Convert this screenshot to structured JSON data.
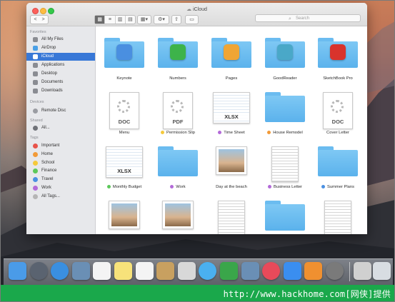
{
  "window": {
    "title": "iCloud",
    "search_placeholder": "Search",
    "nav_back": "<",
    "nav_forward": ">"
  },
  "sidebar": {
    "favorites_header": "Favorites",
    "favorites": [
      {
        "label": "All My Files",
        "icon": "all-files-icon"
      },
      {
        "label": "AirDrop",
        "icon": "airdrop-icon"
      },
      {
        "label": "iCloud",
        "icon": "icloud-icon",
        "active": true
      },
      {
        "label": "Applications",
        "icon": "applications-icon"
      },
      {
        "label": "Desktop",
        "icon": "desktop-icon"
      },
      {
        "label": "Documents",
        "icon": "documents-icon"
      },
      {
        "label": "Downloads",
        "icon": "downloads-icon"
      }
    ],
    "devices_header": "Devices",
    "devices": [
      {
        "label": "Remote Disc",
        "icon": "disc-icon"
      }
    ],
    "shared_header": "Shared",
    "shared": [
      {
        "label": "All...",
        "icon": "network-icon"
      }
    ],
    "tags_header": "Tags",
    "tags": [
      {
        "label": "Important",
        "color": "#e8534a"
      },
      {
        "label": "Home",
        "color": "#f29a38"
      },
      {
        "label": "School",
        "color": "#f5c93b"
      },
      {
        "label": "Finance",
        "color": "#5cc85a"
      },
      {
        "label": "Travel",
        "color": "#4a90e2"
      },
      {
        "label": "Work",
        "color": "#b36ad8"
      },
      {
        "label": "All Tags...",
        "color": "#b5b5b5"
      }
    ]
  },
  "files": [
    {
      "name": "Keynote",
      "kind": "folder",
      "app_color": "#4a8fe0"
    },
    {
      "name": "Numbers",
      "kind": "folder",
      "app_color": "#3db34a"
    },
    {
      "name": "Pages",
      "kind": "folder",
      "app_color": "#f0a534"
    },
    {
      "name": "GoodReader",
      "kind": "folder",
      "app_color": "#4aa8c8"
    },
    {
      "name": "SketchBook Pro",
      "kind": "folder",
      "app_color": "#d9332c"
    },
    {
      "name": "Menu",
      "kind": "doc",
      "ext": "DOC"
    },
    {
      "name": "Permission Slip",
      "kind": "doc",
      "ext": "PDF",
      "tag_color": "#f5c93b"
    },
    {
      "name": "Time Sheet",
      "kind": "sheet",
      "ext": "XLSX",
      "tag_color": "#b36ad8"
    },
    {
      "name": "House Remodel",
      "kind": "folder-plain",
      "tag_color": "#f29a38"
    },
    {
      "name": "Cover Letter",
      "kind": "doc",
      "ext": "DOC"
    },
    {
      "name": "Monthly Budget",
      "kind": "sheet",
      "ext": "XLSX",
      "tag_color": "#5cc85a"
    },
    {
      "name": "Work",
      "kind": "folder-plain",
      "tag_color": "#b36ad8"
    },
    {
      "name": "Day at the beach",
      "kind": "photo"
    },
    {
      "name": "Business Letter",
      "kind": "letter",
      "tag_color": "#b36ad8"
    },
    {
      "name": "Summer Plans",
      "kind": "folder-plain",
      "tag_color": "#4a90e2"
    },
    {
      "name": "",
      "kind": "photo"
    },
    {
      "name": "",
      "kind": "photo"
    },
    {
      "name": "",
      "kind": "letter"
    },
    {
      "name": "",
      "kind": "folder-plain"
    },
    {
      "name": "",
      "kind": "letter"
    }
  ],
  "dock": [
    {
      "name": "finder-icon",
      "color": "#4a9be8"
    },
    {
      "name": "launchpad-icon",
      "color": "#5a6370"
    },
    {
      "name": "safari-icon",
      "color": "#3a8fe0"
    },
    {
      "name": "photo-app-icon",
      "color": "#6a8fb5"
    },
    {
      "name": "calendar-icon",
      "color": "#f4f4f4"
    },
    {
      "name": "notes-icon",
      "color": "#f7e27a"
    },
    {
      "name": "reminders-icon",
      "color": "#f4f4f4"
    },
    {
      "name": "contacts-icon",
      "color": "#c8a060"
    },
    {
      "name": "preview-icon",
      "color": "#d8d8d8"
    },
    {
      "name": "messages-icon",
      "color": "#4ab0f0"
    },
    {
      "name": "facetime-icon",
      "color": "#3aa64a"
    },
    {
      "name": "iphoto-icon",
      "color": "#6a8fb5"
    },
    {
      "name": "itunes-icon",
      "color": "#e84a5a"
    },
    {
      "name": "app-store-icon",
      "color": "#3a8ef0"
    },
    {
      "name": "ibooks-icon",
      "color": "#f09030"
    },
    {
      "name": "system-preferences-icon",
      "color": "#7a7a7a"
    },
    {
      "name": "downloads-stack-icon",
      "color": "#d0d0d0"
    },
    {
      "name": "trash-icon",
      "color": "#d8dde2"
    }
  ],
  "watermark": "http://www.hackhome.com[网侠]提供"
}
